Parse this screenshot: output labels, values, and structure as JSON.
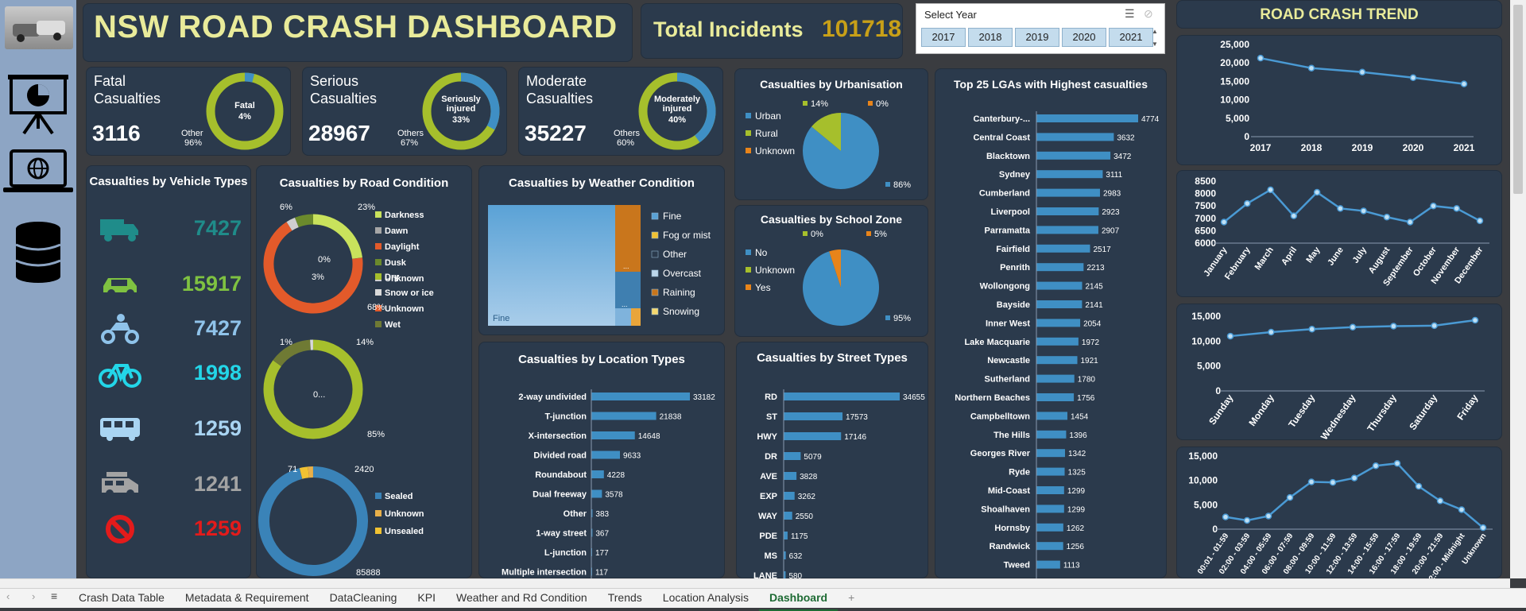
{
  "header": {
    "title": "NSW ROAD CRASH DASHBOARD",
    "total_label": "Total Incidents",
    "total_value": "101718"
  },
  "slicer": {
    "title": "Select Year",
    "years": [
      "2017",
      "2018",
      "2019",
      "2020",
      "2021"
    ]
  },
  "kpis": [
    {
      "title_line1": "Fatal",
      "title_line2": "Casualties",
      "value": "3116",
      "ring_label": "Fatal",
      "ring_pct": "4%",
      "other_label": "Other",
      "other_pct": "96%",
      "fraction": 0.04
    },
    {
      "title_line1": "Serious",
      "title_line2": "Casualties",
      "value": "28967",
      "ring_label": "Seriously injured",
      "ring_pct": "33%",
      "other_label": "Others",
      "other_pct": "67%",
      "fraction": 0.33
    },
    {
      "title_line1": "Moderate",
      "title_line2": "Casualties",
      "value": "35227",
      "ring_label": "Moderately injured",
      "ring_pct": "40%",
      "other_label": "Others",
      "other_pct": "60%",
      "fraction": 0.4
    }
  ],
  "vehicles": {
    "title": "Casualties by  Vehicle Types",
    "items": [
      {
        "icon": "truck-icon",
        "value": "7427",
        "color": "#1f8c8a"
      },
      {
        "icon": "car-icon",
        "value": "15917",
        "color": "#7fc241"
      },
      {
        "icon": "motorcycle-icon",
        "value": "7427",
        "color": "#8fc3ea"
      },
      {
        "icon": "bicycle-icon",
        "value": "1998",
        "color": "#23d6e8"
      },
      {
        "icon": "bus-icon",
        "value": "1259",
        "color": "#a9d4f2"
      },
      {
        "icon": "van-icon",
        "value": "1241",
        "color": "#a3a3a3"
      },
      {
        "icon": "no-vehicle-icon",
        "value": "1259",
        "color": "#e31b1b"
      }
    ]
  },
  "road_condition": {
    "title": "Casualties by Road Condition",
    "lighting": {
      "legend": [
        "Darkness",
        "Dawn",
        "Daylight",
        "Dusk",
        "Unknown"
      ],
      "labels": [
        "6%",
        "23%",
        "0%",
        "3%",
        "68%"
      ]
    },
    "surface": {
      "legend": [
        "Dry",
        "Snow or ice",
        "Unknown",
        "Wet"
      ],
      "labels": [
        "1%",
        "14%",
        "0...",
        "85%"
      ]
    },
    "road": {
      "legend": [
        "Sealed",
        "Unknown",
        "Unsealed"
      ],
      "labels": [
        "71",
        "2420",
        "85888"
      ]
    }
  },
  "weather": {
    "title": "Casualties by Weather Condition",
    "legend": [
      "Fine",
      "Fog or mist",
      "Other",
      "Overcast",
      "Raining",
      "Snowing"
    ],
    "fine_label": "Fine",
    "dots": "..."
  },
  "urbanisation": {
    "title": "Casualties by  Urbanisation",
    "legend": [
      "Urban",
      "Rural",
      "Unknown"
    ],
    "labels": [
      "14%",
      "0%",
      "86%"
    ]
  },
  "school_zone": {
    "title": "Casualties by School Zone",
    "legend": [
      "No",
      "Unknown",
      "Yes"
    ],
    "labels": [
      "0%",
      "5%",
      "95%"
    ]
  },
  "location": {
    "title": "Casualties by Location Types"
  },
  "street": {
    "title": "Casualties by Street Types"
  },
  "lga": {
    "title": "Top 25 LGAs with Highest casualties"
  },
  "trend": {
    "title": "ROAD  CRASH  TREND"
  },
  "chart_data": [
    {
      "type": "bar",
      "id": "location",
      "categories": [
        "2-way undivided",
        "T-junction",
        "X-intersection",
        "Divided road",
        "Roundabout",
        "Dual freeway",
        "Other",
        "1-way street",
        "L-junction",
        "Multiple intersection"
      ],
      "values": [
        33182,
        21838,
        14648,
        9633,
        4228,
        3578,
        383,
        367,
        177,
        117
      ]
    },
    {
      "type": "bar",
      "id": "street",
      "categories": [
        "RD",
        "ST",
        "HWY",
        "DR",
        "AVE",
        "EXP",
        "WAY",
        "PDE",
        "MS",
        "LANE"
      ],
      "values": [
        34655,
        17573,
        17146,
        5079,
        3828,
        3262,
        2550,
        1175,
        632,
        580
      ]
    },
    {
      "type": "bar",
      "id": "lga",
      "categories": [
        "Canterbury-...",
        "Central Coast",
        "Blacktown",
        "Sydney",
        "Cumberland",
        "Liverpool",
        "Parramatta",
        "Fairfield",
        "Penrith",
        "Wollongong",
        "Bayside",
        "Inner West",
        "Lake Macquarie",
        "Newcastle",
        "Sutherland",
        "Northern Beaches",
        "Campbelltown",
        "The Hills",
        "Georges River",
        "Ryde",
        "Mid-Coast",
        "Shoalhaven",
        "Hornsby",
        "Randwick",
        "Tweed"
      ],
      "values": [
        4774,
        3632,
        3472,
        3111,
        2983,
        2923,
        2907,
        2517,
        2213,
        2145,
        2141,
        2054,
        1972,
        1921,
        1780,
        1756,
        1454,
        1396,
        1342,
        1325,
        1299,
        1299,
        1262,
        1256,
        1113
      ]
    },
    {
      "type": "line",
      "id": "year",
      "x": [
        "2017",
        "2018",
        "2019",
        "2020",
        "2021"
      ],
      "y": [
        21300,
        18600,
        17500,
        16000,
        14300
      ],
      "yticks": [
        "25,000",
        "20,000",
        "15,000",
        "10,000",
        "5,000",
        "0"
      ],
      "ylim": [
        0,
        25000
      ]
    },
    {
      "type": "line",
      "id": "month",
      "x": [
        "January",
        "February",
        "March",
        "April",
        "May",
        "June",
        "July",
        "August",
        "September",
        "October",
        "November",
        "December"
      ],
      "y": [
        6850,
        7600,
        8150,
        7100,
        8050,
        7400,
        7300,
        7050,
        6850,
        7500,
        7400,
        6900
      ],
      "yticks": [
        "8500",
        "8000",
        "7500",
        "7000",
        "6500",
        "6000"
      ],
      "ylim": [
        6000,
        8500
      ]
    },
    {
      "type": "line",
      "id": "weekday",
      "x": [
        "Sunday",
        "Monday",
        "Tuesday",
        "Wednesday",
        "Thursday",
        "Saturday",
        "Friday"
      ],
      "y": [
        11000,
        11800,
        12400,
        12800,
        13000,
        13100,
        14200
      ],
      "yticks": [
        "15,000",
        "10,000",
        "5,000",
        "0"
      ],
      "ylim": [
        0,
        15000
      ]
    },
    {
      "type": "line",
      "id": "hour",
      "x": [
        "00:01 - 01:59",
        "02:00 - 03:59",
        "04:00 - 05:59",
        "06:00 - 07:59",
        "08:00 - 09:59",
        "10:00 - 11:59",
        "12:00 - 13:59",
        "14:00 - 15:59",
        "16:00 - 17:59",
        "18:00 - 19:59",
        "20:00 - 21:59",
        "22:00 - Midnight",
        "Unknown"
      ],
      "y": [
        2500,
        1800,
        2700,
        6500,
        9700,
        9600,
        10500,
        13000,
        13500,
        8800,
        5800,
        4000,
        300
      ],
      "yticks": [
        "15,000",
        "10,000",
        "5,000",
        "0"
      ],
      "ylim": [
        0,
        15000
      ]
    }
  ],
  "sheet_tabs": [
    "Crash Data Table",
    "Metadata & Requirement",
    "DataCleaning",
    "KPI",
    "Weather and Rd Condition",
    "Trends",
    "Location Analysis",
    "Dashboard"
  ],
  "colors": {
    "panel": "#2b3a4c",
    "bar": "#3f8fc4",
    "accent": "#a6bf2c",
    "title": "#e9eb9a",
    "gold": "#c8a018"
  }
}
